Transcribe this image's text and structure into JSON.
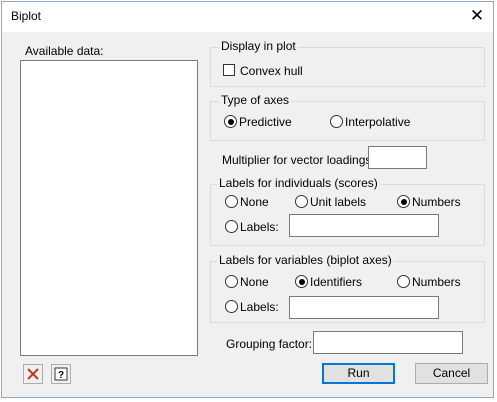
{
  "window": {
    "title": "Biplot"
  },
  "available_data": {
    "label": "Available data:"
  },
  "display_in_plot": {
    "title": "Display in plot",
    "convex_hull_label": "Convex hull",
    "convex_hull_checked": false
  },
  "type_of_axes": {
    "title": "Type of axes",
    "options": [
      "Predictive",
      "Interpolative"
    ],
    "selected": "Predictive"
  },
  "multiplier": {
    "label": "Multiplier for vector loadings:",
    "value": ""
  },
  "labels_individuals": {
    "title": "Labels for individuals (scores)",
    "options": [
      "None",
      "Unit labels",
      "Numbers",
      "Labels:"
    ],
    "selected": "Numbers",
    "labels_value": ""
  },
  "labels_variables": {
    "title": "Labels for variables (biplot axes)",
    "options": [
      "None",
      "Identifiers",
      "Numbers",
      "Labels:"
    ],
    "selected": "Identifiers",
    "labels_value": ""
  },
  "grouping_factor": {
    "label": "Grouping factor:",
    "value": ""
  },
  "buttons": {
    "run": "Run",
    "cancel": "Cancel"
  },
  "icons": {
    "close": "close-icon",
    "clear": "clear-icon",
    "help": "help-icon"
  },
  "colors": {
    "clear_red": "#c0392b",
    "default_button_border": "#0078d7"
  }
}
